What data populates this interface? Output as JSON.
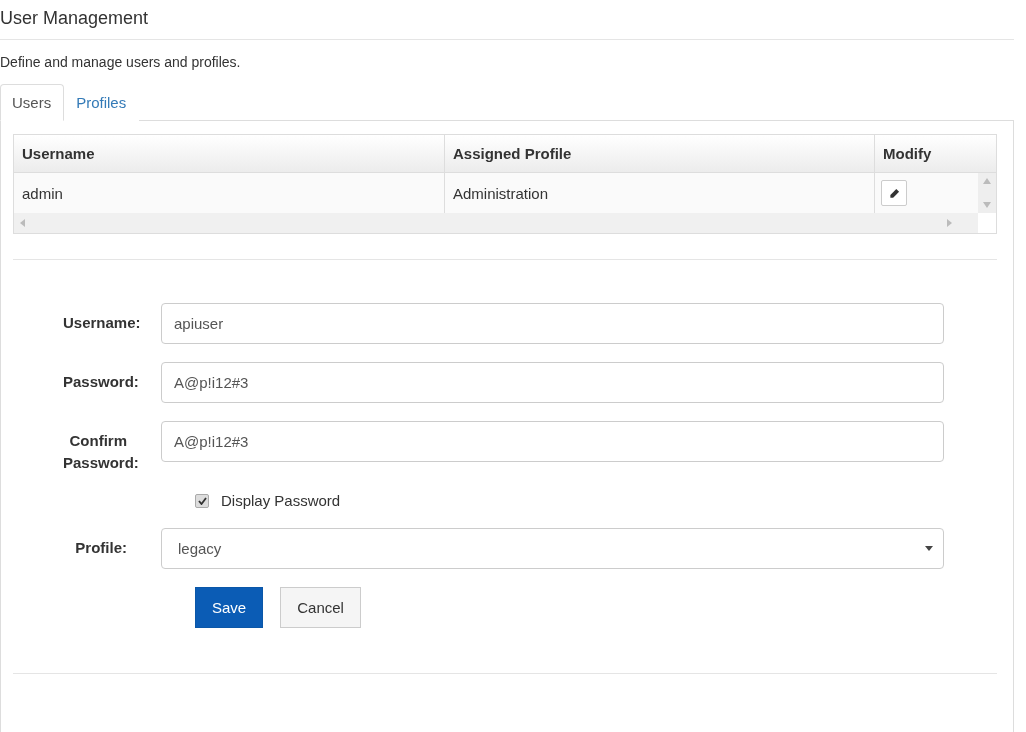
{
  "page": {
    "title": "User Management",
    "description": "Define and manage users and profiles."
  },
  "tabs": [
    {
      "label": "Users",
      "selected": true
    },
    {
      "label": "Profiles",
      "selected": false
    }
  ],
  "table": {
    "columns": [
      "Username",
      "Assigned Profile",
      "Modify"
    ],
    "rows": [
      {
        "cells": [
          "admin",
          "Administration"
        ]
      }
    ]
  },
  "form": {
    "fields": [
      {
        "kind": "text",
        "label": "Username:",
        "value": "apiuser"
      },
      {
        "kind": "text",
        "label": "Password:",
        "value": "A@p!i12#3"
      },
      {
        "kind": "text",
        "label": "Confirm Password:",
        "value": "A@p!i12#3"
      },
      {
        "kind": "checkbox",
        "label": "Display Password",
        "checked": true
      },
      {
        "kind": "select",
        "label": "Profile:",
        "value": "legacy"
      }
    ],
    "buttons": [
      {
        "label": "Save",
        "kind": "primary"
      },
      {
        "label": "Cancel",
        "kind": "default"
      }
    ]
  }
}
